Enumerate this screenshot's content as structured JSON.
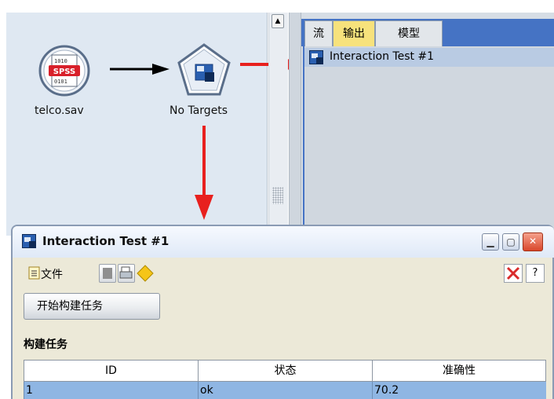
{
  "canvas": {
    "nodes": [
      {
        "label": "telco.sav",
        "icon": "spss-data-file-icon"
      },
      {
        "label": "No Targets",
        "icon": "interaction-model-node-icon"
      }
    ]
  },
  "manager": {
    "tabs": [
      "流",
      "输出",
      "模型"
    ],
    "active_tab": "输出",
    "items": [
      {
        "label": "Interaction Test #1"
      }
    ]
  },
  "window": {
    "title": "Interaction Test #1",
    "file_menu": "文件",
    "start_button": "开始构建任务",
    "section_title": "构建任务",
    "table": {
      "headers": [
        "ID",
        "状态",
        "准确性"
      ],
      "rows": [
        [
          "1",
          "ok",
          "70.2"
        ]
      ]
    }
  },
  "colors": {
    "annotation_arrow": "#e8201e",
    "tab_bar": "#4573c4",
    "active_tab": "#f7e27c",
    "selected_row": "#8fb6e3"
  }
}
